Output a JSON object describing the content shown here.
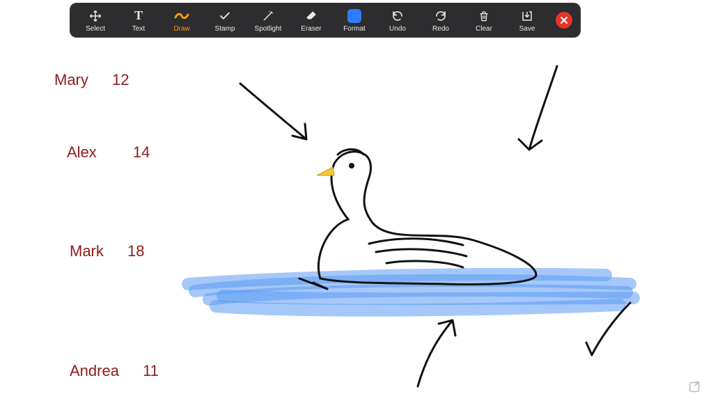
{
  "toolbar": {
    "tools": [
      {
        "id": "select",
        "label": "Select"
      },
      {
        "id": "text",
        "label": "Text"
      },
      {
        "id": "draw",
        "label": "Draw"
      },
      {
        "id": "stamp",
        "label": "Stamp"
      },
      {
        "id": "spotlight",
        "label": "Spotlight"
      },
      {
        "id": "eraser",
        "label": "Eraser"
      },
      {
        "id": "format",
        "label": "Format"
      },
      {
        "id": "undo",
        "label": "Undo"
      },
      {
        "id": "redo",
        "label": "Redo"
      },
      {
        "id": "clear",
        "label": "Clear"
      },
      {
        "id": "save",
        "label": "Save"
      }
    ],
    "active": "draw",
    "format_color": "#2f7bff"
  },
  "annotations": {
    "entries": [
      {
        "name": "Mary",
        "value": "12"
      },
      {
        "name": "Alex",
        "value": "14"
      },
      {
        "name": "Mark",
        "value": "18"
      },
      {
        "name": "Andrea",
        "value": "11"
      }
    ]
  }
}
